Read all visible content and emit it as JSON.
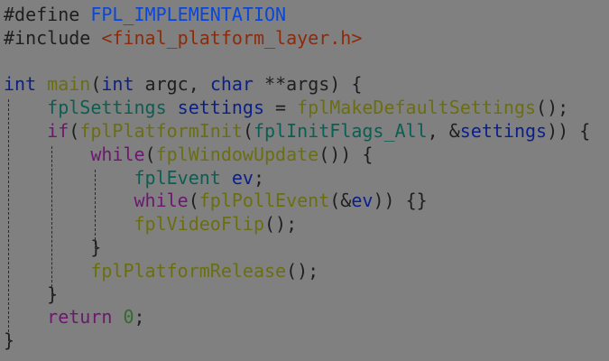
{
  "colors": {
    "background": "#808080",
    "preprocessor": "#1e1e1e",
    "macro": "#0a47d6",
    "include_path": "#8a2b0c",
    "keyword_type": "#0a1f8a",
    "function": "#6b6e10",
    "type": "#0a5e52",
    "variable": "#0a1f8a",
    "control": "#6e1670",
    "number": "#2e6e2a",
    "punctuation": "#1e1e1e",
    "indent_guide": "#2a2a2a"
  },
  "lines": [
    [
      {
        "t": "#define ",
        "c": "preprocessor"
      },
      {
        "t": "FPL_IMPLEMENTATION",
        "c": "macro"
      }
    ],
    [
      {
        "t": "#include ",
        "c": "preprocessor"
      },
      {
        "t": "<final_platform_layer.h>",
        "c": "include_path"
      }
    ],
    [],
    [
      {
        "t": "int",
        "c": "keyword_type"
      },
      {
        "t": " ",
        "c": "punctuation"
      },
      {
        "t": "main",
        "c": "function"
      },
      {
        "t": "(",
        "c": "punctuation"
      },
      {
        "t": "int",
        "c": "keyword_type"
      },
      {
        "t": " argc, ",
        "c": "punctuation"
      },
      {
        "t": "char",
        "c": "keyword_type"
      },
      {
        "t": " **args) {",
        "c": "punctuation"
      }
    ],
    [
      {
        "t": "    ",
        "c": "punctuation"
      },
      {
        "t": "fplSettings",
        "c": "type"
      },
      {
        "t": " ",
        "c": "punctuation"
      },
      {
        "t": "settings",
        "c": "variable"
      },
      {
        "t": " = ",
        "c": "punctuation"
      },
      {
        "t": "fplMakeDefaultSettings",
        "c": "function"
      },
      {
        "t": "();",
        "c": "punctuation"
      }
    ],
    [
      {
        "t": "    ",
        "c": "punctuation"
      },
      {
        "t": "if",
        "c": "control"
      },
      {
        "t": "(",
        "c": "punctuation"
      },
      {
        "t": "fplPlatformInit",
        "c": "function"
      },
      {
        "t": "(",
        "c": "punctuation"
      },
      {
        "t": "fplInitFlags_All",
        "c": "type"
      },
      {
        "t": ", &",
        "c": "punctuation"
      },
      {
        "t": "settings",
        "c": "variable"
      },
      {
        "t": ")) {",
        "c": "punctuation"
      }
    ],
    [
      {
        "t": "        ",
        "c": "punctuation"
      },
      {
        "t": "while",
        "c": "control"
      },
      {
        "t": "(",
        "c": "punctuation"
      },
      {
        "t": "fplWindowUpdate",
        "c": "function"
      },
      {
        "t": "()) {",
        "c": "punctuation"
      }
    ],
    [
      {
        "t": "            ",
        "c": "punctuation"
      },
      {
        "t": "fplEvent",
        "c": "type"
      },
      {
        "t": " ",
        "c": "punctuation"
      },
      {
        "t": "ev",
        "c": "variable"
      },
      {
        "t": ";",
        "c": "punctuation"
      }
    ],
    [
      {
        "t": "            ",
        "c": "punctuation"
      },
      {
        "t": "while",
        "c": "control"
      },
      {
        "t": "(",
        "c": "punctuation"
      },
      {
        "t": "fplPollEvent",
        "c": "function"
      },
      {
        "t": "(&",
        "c": "punctuation"
      },
      {
        "t": "ev",
        "c": "variable"
      },
      {
        "t": ")) {}",
        "c": "punctuation"
      }
    ],
    [
      {
        "t": "            ",
        "c": "punctuation"
      },
      {
        "t": "fplVideoFlip",
        "c": "function"
      },
      {
        "t": "();",
        "c": "punctuation"
      }
    ],
    [
      {
        "t": "        }",
        "c": "punctuation"
      }
    ],
    [
      {
        "t": "        ",
        "c": "punctuation"
      },
      {
        "t": "fplPlatformRelease",
        "c": "function"
      },
      {
        "t": "();",
        "c": "punctuation"
      }
    ],
    [
      {
        "t": "    }",
        "c": "punctuation"
      }
    ],
    [
      {
        "t": "    ",
        "c": "punctuation"
      },
      {
        "t": "return",
        "c": "control"
      },
      {
        "t": " ",
        "c": "punctuation"
      },
      {
        "t": "0",
        "c": "number"
      },
      {
        "t": ";",
        "c": "punctuation"
      }
    ],
    [
      {
        "t": "}",
        "c": "punctuation"
      }
    ]
  ]
}
